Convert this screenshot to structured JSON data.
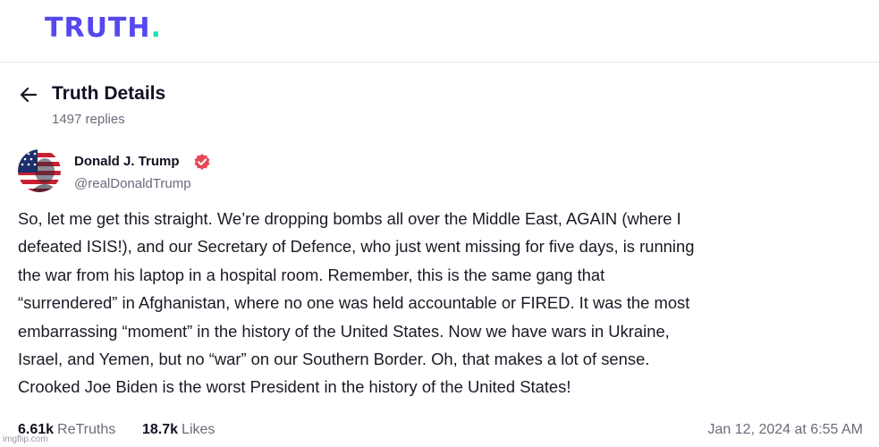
{
  "brand": {
    "logo_text": "TRUTH",
    "logo_dot": ".",
    "primary_color": "#5448ee",
    "accent_color": "#17e3b5"
  },
  "header": {
    "back_icon": "arrow-left-icon",
    "title": "Truth Details",
    "reply_count": "1497 replies"
  },
  "post": {
    "author": {
      "name": "Donald J. Trump",
      "handle": "@realDonaldTrump",
      "verified_icon": "verified-badge-icon",
      "verified_color": "#e8495a"
    },
    "lines": [
      "So, let me get this straight. We’re dropping bombs all over the Middle East, AGAIN (where I",
      "defeated ISIS!), and our Secretary of Defence, who just went missing for five days, is running",
      "the war from his laptop in a hospital room. Remember, this is the same gang that",
      "“surrendered” in Afghanistan, where no one was held accountable or FIRED. It was the most",
      "embarrassing “moment” in the history of the United States. Now we have wars in Ukraine,",
      "Israel, and Yemen, but no “war” on our Southern Border. Oh, that makes a lot of sense.",
      "Crooked Joe Biden is the worst President in the history of the United States!"
    ],
    "stats": {
      "retruths_count": "6.61k",
      "retruths_label": "ReTruths",
      "likes_count": "18.7k",
      "likes_label": "Likes"
    },
    "timestamp": "Jan 12, 2024 at 6:55 AM"
  },
  "watermark": "imgflip.com"
}
